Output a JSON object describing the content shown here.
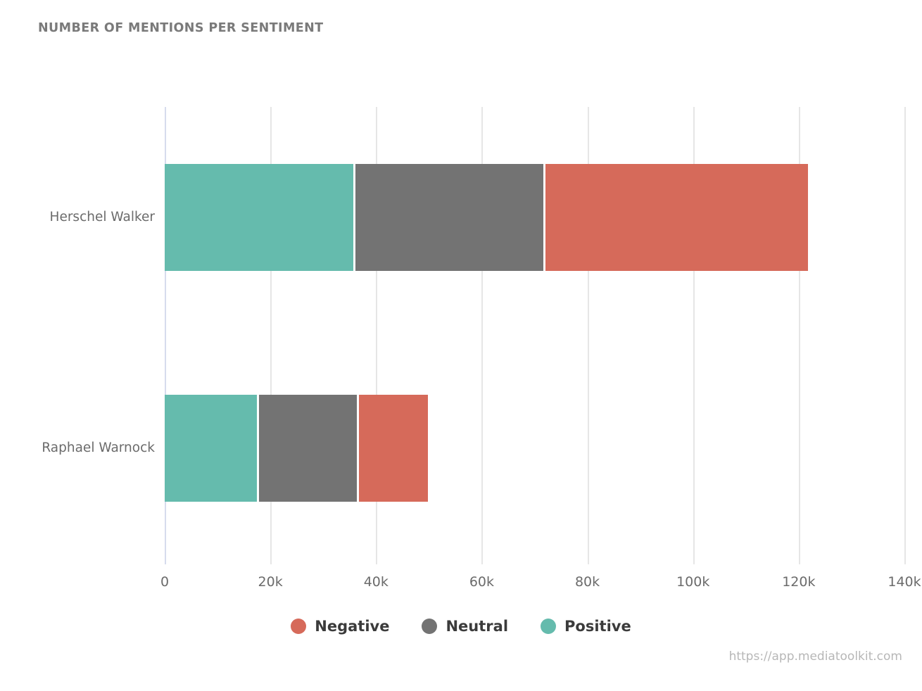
{
  "chart": {
    "title": "NUMBER OF MENTIONS PER SENTIMENT",
    "footer_url": "https://app.mediatoolkit.com"
  },
  "legend": {
    "items": [
      {
        "label": "Negative",
        "color": "#d66a5a",
        "key": "negative"
      },
      {
        "label": "Neutral",
        "color": "#737373",
        "key": "neutral"
      },
      {
        "label": "Positive",
        "color": "#65bbad",
        "key": "positive"
      }
    ]
  },
  "axis": {
    "x_ticks": [
      "0",
      "20k",
      "40k",
      "60k",
      "80k",
      "100k",
      "120k",
      "140k"
    ],
    "x_tick_values": [
      0,
      20000,
      40000,
      60000,
      80000,
      100000,
      120000,
      140000
    ]
  },
  "chart_data": {
    "type": "bar",
    "orientation": "horizontal",
    "stacked": true,
    "title": "NUMBER OF MENTIONS PER SENTIMENT",
    "xlabel": "",
    "ylabel": "",
    "xlim": [
      0,
      140000
    ],
    "grid": true,
    "legend_position": "bottom",
    "categories": [
      "Herschel Walker",
      "Raphael Warnock"
    ],
    "series": [
      {
        "name": "Positive",
        "color": "#65bbad",
        "values": [
          36100,
          17900
        ]
      },
      {
        "name": "Neutral",
        "color": "#737373",
        "values": [
          36000,
          18800
        ]
      },
      {
        "name": "Negative",
        "color": "#d66a5a",
        "values": [
          50000,
          13500
        ]
      }
    ],
    "stack_order": [
      "Positive",
      "Neutral",
      "Negative"
    ],
    "totals": [
      122100,
      50200
    ],
    "x_tick_labels": [
      "0",
      "20k",
      "40k",
      "60k",
      "80k",
      "100k",
      "120k",
      "140k"
    ]
  }
}
